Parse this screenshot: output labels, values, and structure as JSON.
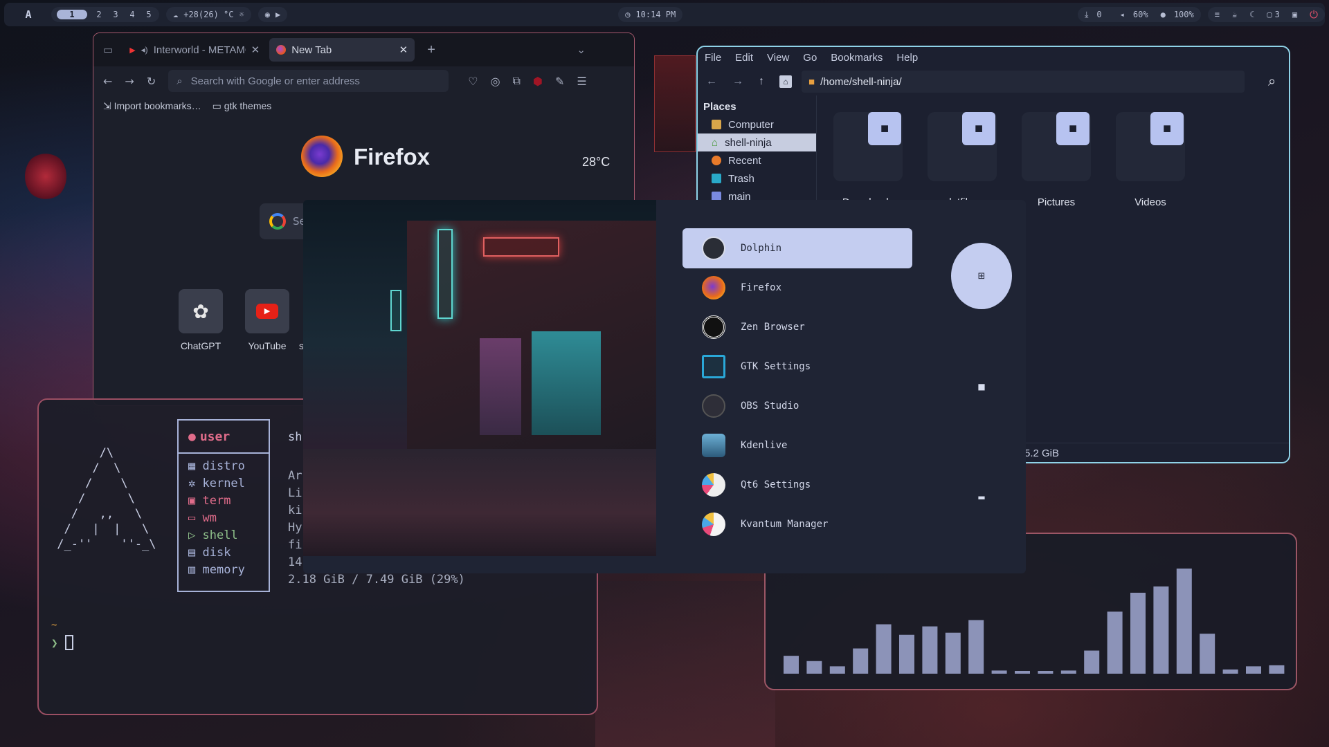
{
  "topbar": {
    "logo": "A",
    "workspaces": [
      "1",
      "2",
      "3",
      "4",
      "5"
    ],
    "active_workspace": "1",
    "weather": "+28(26) °C",
    "clock": "10:14 PM",
    "updates": "0",
    "volume": "60%",
    "mic": "100%",
    "windows_count": "3"
  },
  "browser": {
    "tabs": [
      {
        "title": "Interworld - METAMO",
        "active": false
      },
      {
        "title": "New Tab",
        "active": true
      }
    ],
    "url_placeholder": "Search with Google or enter address",
    "bookmarks": [
      "Import bookmarks…",
      "gtk themes"
    ],
    "brand": "Firefox",
    "temperature": "28°C",
    "search_placeholder_partial": "Se",
    "shortcuts": [
      "ChatGPT",
      "YouTube",
      "s"
    ]
  },
  "files": {
    "menu": [
      "File",
      "Edit",
      "View",
      "Go",
      "Bookmarks",
      "Help"
    ],
    "path": "/home/shell-ninja/",
    "places_title": "Places",
    "places": [
      {
        "label": "Computer",
        "active": false
      },
      {
        "label": "shell-ninja",
        "active": true
      },
      {
        "label": "Recent",
        "active": false
      },
      {
        "label": "Trash",
        "active": false
      },
      {
        "label": "main",
        "active": false
      }
    ],
    "folders": [
      "Downloads",
      "dotfiles",
      "Pictures",
      "Videos"
    ],
    "status": "5.2 GiB"
  },
  "launcher": {
    "apps": [
      "Dolphin",
      "Firefox",
      "Zen Browser",
      "GTK Settings",
      "OBS Studio",
      "Kdenlive",
      "Qt6 Settings",
      "Kvantum Manager"
    ],
    "selected": "Dolphin"
  },
  "terminal": {
    "fetch_labels": [
      "user",
      "distro",
      "kernel",
      "term",
      "wm",
      "shell",
      "disk",
      "memory"
    ],
    "fetch_values_partial": [
      "sh",
      "Ar",
      "Li",
      "ki",
      "Hy",
      "fi",
      "14",
      "2.18 GiB / 7.49 GiB (29%)"
    ],
    "prompt_dir": "~",
    "prompt_symbol": "❯"
  },
  "visualizer": {
    "bars": [
      0.17,
      0.12,
      0.07,
      0.24,
      0.47,
      0.37,
      0.45,
      0.39,
      0.51,
      0.03,
      0.02,
      0.02,
      0.03,
      0.22,
      0.59,
      0.77,
      0.83,
      1.0,
      0.38,
      0.04,
      0.07,
      0.08
    ]
  },
  "colors": {
    "accent": "#c4cdf0",
    "terminal_red": "#e06c8a",
    "terminal_green": "#8fc08a",
    "files_border": "#8fd3e8"
  }
}
